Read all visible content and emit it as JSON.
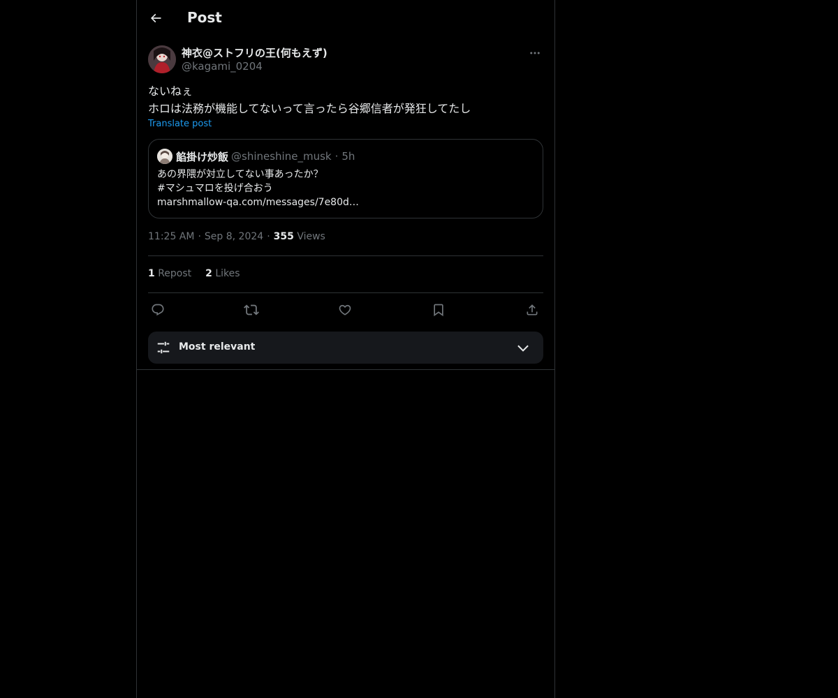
{
  "header": {
    "title": "Post",
    "back_icon": "arrow-left-icon"
  },
  "post": {
    "author_name": "神衣@ストフリの王(何もえず)",
    "author_handle": "@kagami_0204",
    "text_line1": "ないねぇ",
    "text_line2": "ホロは法務が機能してないって言ったら谷郷信者が発狂してたし",
    "translate_label": "Translate post",
    "time": "11:25 AM",
    "date": "Sep 8, 2024",
    "views_count": "355",
    "views_label": "Views"
  },
  "quote": {
    "name": "餡掛け炒飯",
    "handle": "@shineshine_musk",
    "time": "5h",
    "line1": "あの界隈が対立してない事あったか？",
    "line2": "#マシュマロを投げ合おう",
    "line3": "marshmallow-qa.com/messages/7e80d…"
  },
  "stats": {
    "reposts_count": "1",
    "reposts_label": "Repost",
    "likes_count": "2",
    "likes_label": "Likes"
  },
  "actions": [
    "reply-icon",
    "repost-icon",
    "like-icon",
    "bookmark-icon",
    "share-icon"
  ],
  "sort": {
    "label": "Most relevant",
    "icon": "sliders-icon"
  },
  "colors": {
    "background": "#000000",
    "text_primary": "#e7e9ea",
    "text_secondary": "#71767b",
    "accent": "#1d9bf0",
    "border": "#2f3336",
    "sort_bar_bg": "#16181c"
  }
}
